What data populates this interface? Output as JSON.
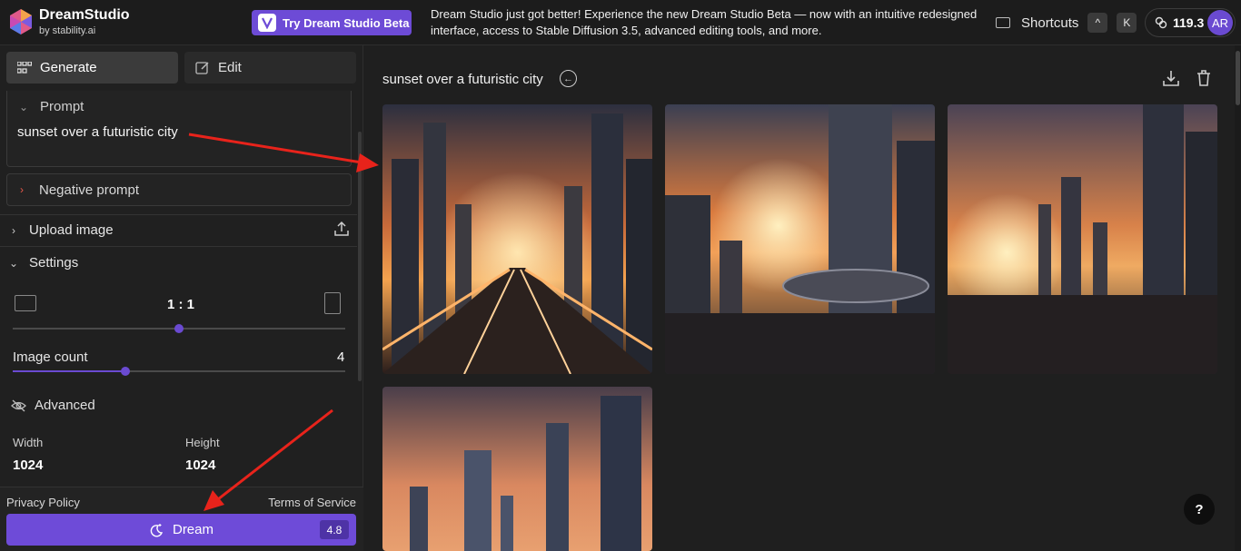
{
  "brand": {
    "title": "DreamStudio",
    "subtitle": "by stability.ai"
  },
  "topbar": {
    "beta_button": "Try Dream Studio Beta",
    "announcement": "Dream Studio just got better! Experience the new Dream Studio Beta — now with an intuitive redesigned interface, access to Stable Diffusion 3.5, advanced editing tools, and more.",
    "shortcuts_label": "Shortcuts",
    "shortcut_keys": [
      "^",
      "K"
    ],
    "credits": "119.3",
    "avatar_initials": "AR"
  },
  "tabs": {
    "generate": "Generate",
    "edit": "Edit"
  },
  "prompt": {
    "label": "Prompt",
    "value": "sunset over a futuristic city"
  },
  "negative_prompt": {
    "label": "Negative prompt"
  },
  "upload_image": {
    "label": "Upload image"
  },
  "settings": {
    "label": "Settings",
    "aspect_ratio": "1 : 1",
    "image_count_label": "Image count",
    "image_count": "4",
    "advanced_label": "Advanced",
    "width_label": "Width",
    "width": "1024",
    "height_label": "Height",
    "height": "1024"
  },
  "footer": {
    "privacy": "Privacy Policy",
    "terms": "Terms of Service",
    "dream_label": "Dream",
    "dream_cost": "4.8"
  },
  "main": {
    "title": "sunset over a futuristic city",
    "help": "?"
  },
  "colors": {
    "accent": "#6e4bd8",
    "annotation_arrow": "#e8231b"
  },
  "images": [
    {
      "alt": "futuristic city sunset 1"
    },
    {
      "alt": "futuristic city sunset 2"
    },
    {
      "alt": "futuristic city sunset 3"
    },
    {
      "alt": "futuristic city sunset 4"
    }
  ]
}
